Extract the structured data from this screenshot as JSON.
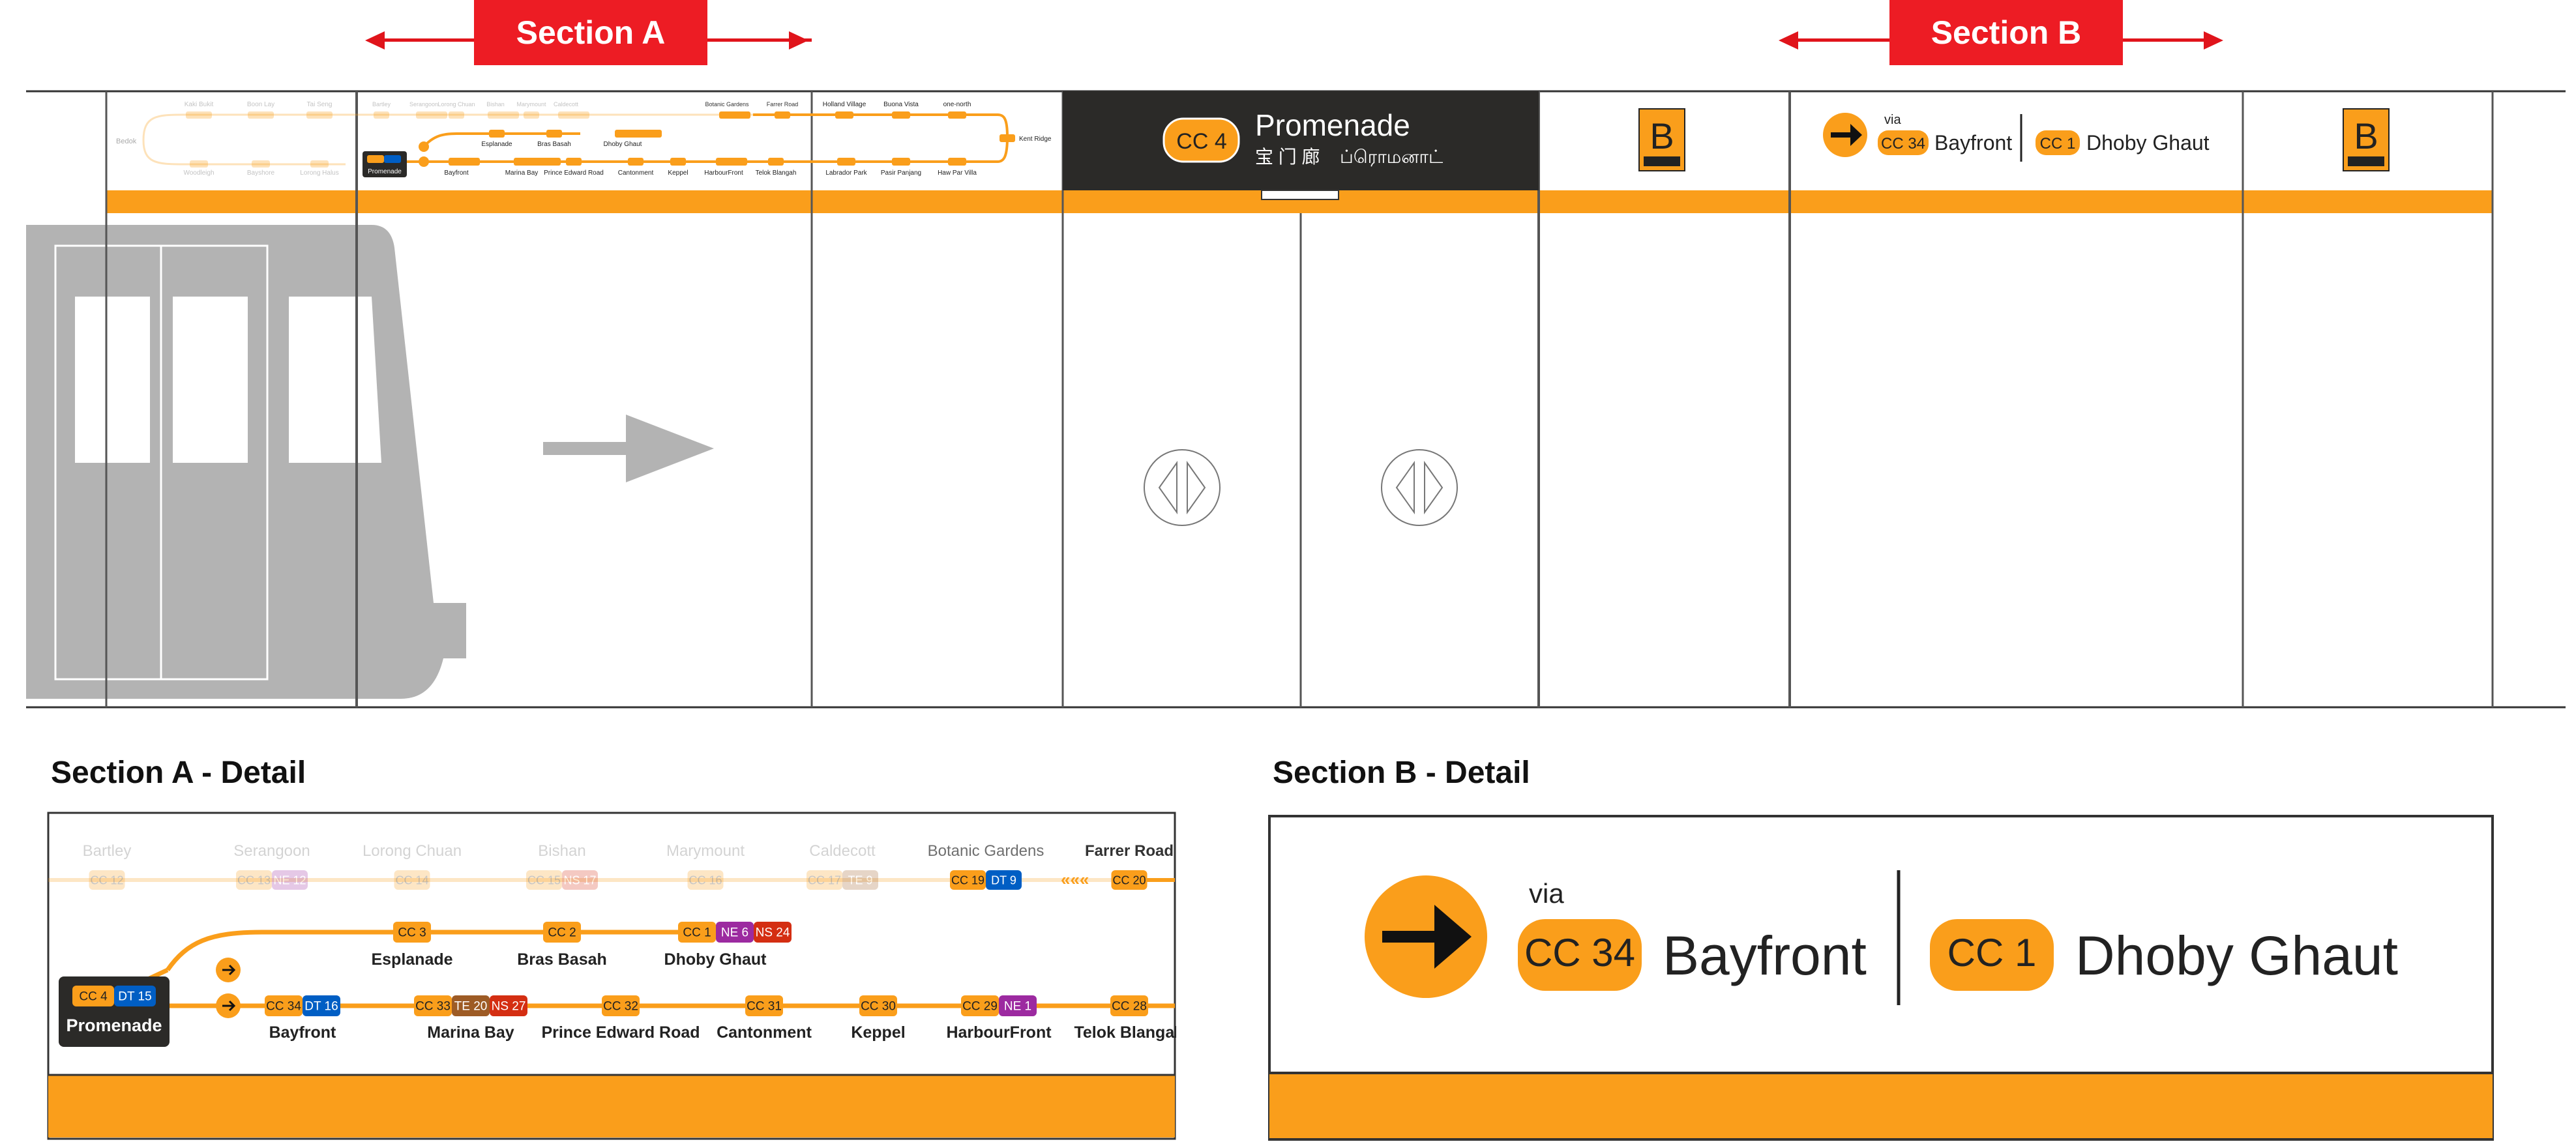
{
  "section_a_label": "Section A",
  "section_b_label": "Section B",
  "detail_a_title": "Section A - Detail",
  "detail_b_title": "Section B - Detail",
  "station": {
    "code": "CC 4",
    "name": "Promenade",
    "name_cn": "宝 门 廊",
    "name_ta": "ப்ரொமனாட்"
  },
  "exit_label": "B",
  "direction": {
    "via": "via",
    "via_code": "CC 34",
    "via_name": "Bayfront",
    "dest_code": "CC 1",
    "dest_name": "Dhoby Ghaut"
  },
  "map_a": {
    "faded_stations": [
      {
        "name": "Bartley",
        "codes": [
          {
            "c": "CC 12",
            "k": "cc"
          }
        ]
      },
      {
        "name": "Serangoon",
        "codes": [
          {
            "c": "CC 13",
            "k": "cc"
          },
          {
            "c": "NE 12",
            "k": "ne"
          }
        ]
      },
      {
        "name": "Lorong Chuan",
        "codes": [
          {
            "c": "CC 14",
            "k": "cc"
          }
        ]
      },
      {
        "name": "Bishan",
        "codes": [
          {
            "c": "CC 15",
            "k": "cc"
          },
          {
            "c": "NS 17",
            "k": "ns"
          }
        ]
      },
      {
        "name": "Marymount",
        "codes": [
          {
            "c": "CC 16",
            "k": "cc"
          }
        ]
      },
      {
        "name": "Caldecott",
        "codes": [
          {
            "c": "CC 17",
            "k": "cc"
          },
          {
            "c": "TE 9",
            "k": "te"
          }
        ]
      },
      {
        "name": "Botanic Gardens",
        "codes": [
          {
            "c": "CC 19",
            "k": "cc"
          },
          {
            "c": "DT 9",
            "k": "dt"
          }
        ]
      },
      {
        "name": "Farrer Road",
        "codes": [
          {
            "c": "CC 20",
            "k": "cc"
          }
        ]
      }
    ],
    "branch_stations": [
      {
        "name": "Esplanade",
        "codes": [
          {
            "c": "CC 3",
            "k": "cc"
          }
        ]
      },
      {
        "name": "Bras Basah",
        "codes": [
          {
            "c": "CC 2",
            "k": "cc"
          }
        ]
      },
      {
        "name": "Dhoby Ghaut",
        "codes": [
          {
            "c": "CC 1",
            "k": "cc"
          },
          {
            "c": "NE 6",
            "k": "ne"
          },
          {
            "c": "NS 24",
            "k": "ns"
          }
        ]
      }
    ],
    "main_stations": [
      {
        "name": "Bayfront",
        "codes": [
          {
            "c": "CC 34",
            "k": "cc"
          },
          {
            "c": "DT 16",
            "k": "dt"
          }
        ]
      },
      {
        "name": "Marina Bay",
        "codes": [
          {
            "c": "CC 33",
            "k": "cc"
          },
          {
            "c": "TE 20",
            "k": "te"
          },
          {
            "c": "NS 27",
            "k": "ns"
          }
        ]
      },
      {
        "name": "Prince Edward Road",
        "codes": [
          {
            "c": "CC 32",
            "k": "cc"
          }
        ]
      },
      {
        "name": "Cantonment",
        "codes": [
          {
            "c": "CC 31",
            "k": "cc"
          }
        ]
      },
      {
        "name": "Keppel",
        "codes": [
          {
            "c": "CC 30",
            "k": "cc"
          }
        ]
      },
      {
        "name": "HarbourFront",
        "codes": [
          {
            "c": "CC 29",
            "k": "cc"
          },
          {
            "c": "NE 1",
            "k": "ne"
          }
        ]
      },
      {
        "name": "Telok Blangah",
        "codes": [
          {
            "c": "CC 28",
            "k": "cc"
          }
        ]
      }
    ],
    "current": {
      "name": "Promenade",
      "codes": [
        {
          "c": "CC 4",
          "k": "cc"
        },
        {
          "c": "DT 15",
          "k": "dt"
        }
      ]
    }
  },
  "map_small": {
    "faded_bottom": [
      "Woodleigh",
      "Bayshore",
      "Lorong Halus"
    ],
    "faded_top": [
      "Kaki Bukit",
      "Boon Lay",
      "Tai Seng"
    ],
    "faded_top_left": "Bedok",
    "right_branch": [
      {
        "name": "Holland Village",
        "code": "CC 21"
      },
      {
        "name": "Buona Vista",
        "code": "CC 22"
      },
      {
        "name": "one-north",
        "code": "CC 23"
      }
    ],
    "right_main": [
      {
        "name": "Labrador Park",
        "code": "CC 27"
      },
      {
        "name": "Pasir Panjang",
        "code": "CC 26"
      },
      {
        "name": "Haw Par Villa",
        "code": "CC 25"
      }
    ],
    "terminal": {
      "name": "Kent Ridge",
      "code": "CC 24"
    }
  },
  "colors": {
    "orange": "#fa9e1b",
    "dark": "#2b2a28",
    "grey_train": "#b3b3b3",
    "ne": "#9c2aa0",
    "ns": "#d42e12",
    "dt": "#005ec4",
    "te": "#9d5b25",
    "red": "#ed1c24"
  }
}
